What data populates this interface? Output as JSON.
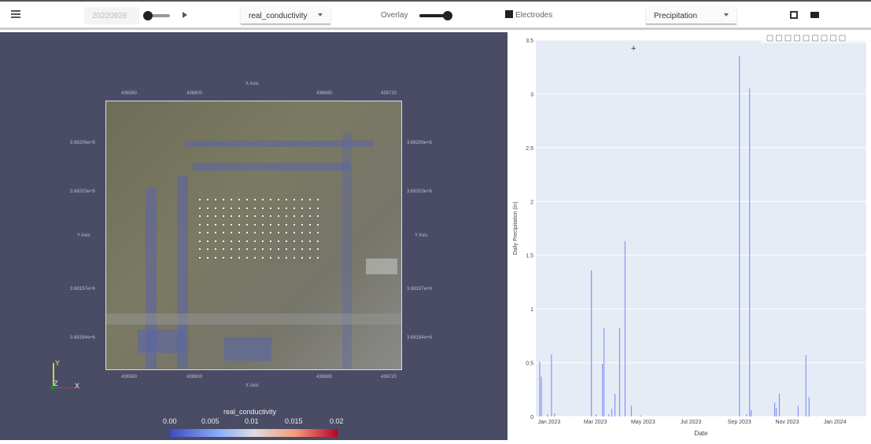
{
  "toolbar": {
    "date": "20220928",
    "field_select": "real_conductivity",
    "overlay_label": "Overlay",
    "overlay_on": true,
    "electrodes_label": "Electrodes",
    "electrodes_checked": true,
    "data_select": "Precipitation",
    "icons": [
      "menu-icon",
      "play-icon",
      "fullscreen-icon",
      "video-camera-icon"
    ]
  },
  "view3d": {
    "x_axis_title": "X Axis",
    "y_axis_title": "Y Axis",
    "x_ticks": [
      "436560",
      "436600",
      "436680",
      "436720"
    ],
    "y_ticks": [
      "3.68206e+6",
      "3.68203e+6",
      "3.68197e+6",
      "3.68194e+6"
    ],
    "orientation": {
      "y": "Y",
      "z": "Z",
      "x": "X"
    },
    "colorbar": {
      "title": "real_conductivity",
      "ticks": [
        "0.00",
        "0.005",
        "0.01",
        "0.015",
        "0.02"
      ],
      "colormap": "cool-warm"
    }
  },
  "chart_data": {
    "type": "bar",
    "xlabel": "Date",
    "ylabel": "Daily Precipitation (in)",
    "ylim": [
      0,
      3.5
    ],
    "xlim": [
      "2022-12-15",
      "2024-02-10"
    ],
    "y_ticks": [
      "0",
      "0.5",
      "1",
      "1.5",
      "2",
      "2.5",
      "3",
      "3.5"
    ],
    "x_ticks": [
      {
        "label": "Jan 2023",
        "date": "2023-01-01"
      },
      {
        "label": "Mar 2023",
        "date": "2023-03-01"
      },
      {
        "label": "May 2023",
        "date": "2023-05-01"
      },
      {
        "label": "Jul 2023",
        "date": "2023-07-01"
      },
      {
        "label": "Sep 2023",
        "date": "2023-09-01"
      },
      {
        "label": "Nov 2023",
        "date": "2023-11-01"
      },
      {
        "label": "Jan 2024",
        "date": "2024-01-01"
      }
    ],
    "color": "#636efa",
    "grid": true,
    "points": [
      [
        "2022-12-20",
        0.51
      ],
      [
        "2022-12-22",
        0.37
      ],
      [
        "2022-12-30",
        0.02
      ],
      [
        "2023-01-04",
        0.58
      ],
      [
        "2023-01-08",
        0.03
      ],
      [
        "2023-02-24",
        1.36
      ],
      [
        "2023-03-02",
        0.02
      ],
      [
        "2023-03-10",
        0.49
      ],
      [
        "2023-03-12",
        0.82
      ],
      [
        "2023-03-18",
        0.02
      ],
      [
        "2023-03-22",
        0.07
      ],
      [
        "2023-03-26",
        0.21
      ],
      [
        "2023-04-01",
        0.82
      ],
      [
        "2023-04-08",
        1.63
      ],
      [
        "2023-04-16",
        0.1
      ],
      [
        "2023-04-28",
        0.01
      ],
      [
        "2023-09-01",
        3.35
      ],
      [
        "2023-09-10",
        0.02
      ],
      [
        "2023-09-14",
        3.05
      ],
      [
        "2023-09-16",
        0.06
      ],
      [
        "2023-10-16",
        0.13
      ],
      [
        "2023-10-18",
        0.08
      ],
      [
        "2023-10-22",
        0.21
      ],
      [
        "2023-11-15",
        0.1
      ],
      [
        "2023-11-25",
        0.57
      ],
      [
        "2023-11-29",
        0.18
      ]
    ],
    "modebar": [
      "camera-icon",
      "zoom-icon",
      "pan-icon",
      "box-select-icon",
      "lasso-icon",
      "zoom-in-icon",
      "zoom-out-icon",
      "autoscale-icon",
      "home-icon"
    ]
  }
}
